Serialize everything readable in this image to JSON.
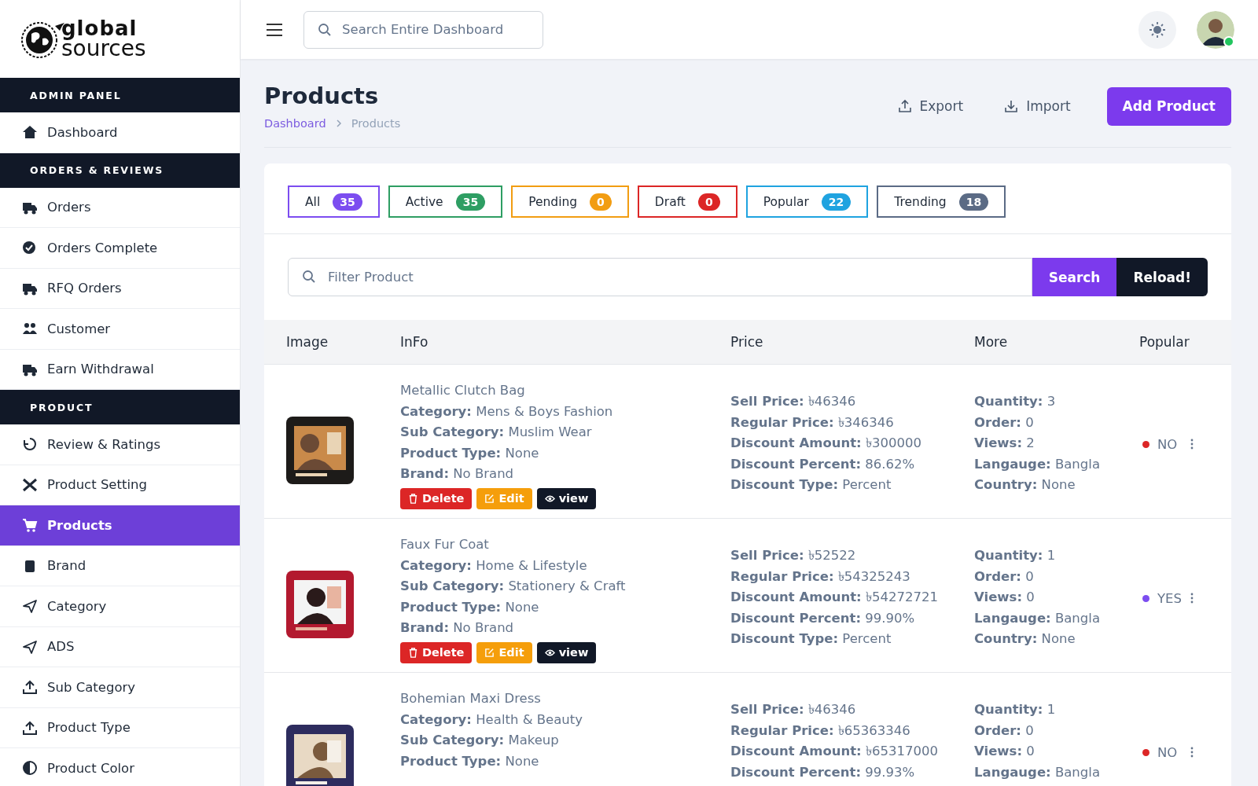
{
  "logo": {
    "line_1": "global",
    "line_2": "sources"
  },
  "sidebar": [
    {
      "heading": "ADMIN PANEL",
      "items": [
        {
          "label": "Dashboard",
          "selected": false
        }
      ]
    },
    {
      "heading": "ORDERS & REVIEWS",
      "items": [
        {
          "label": "Orders",
          "selected": false
        },
        {
          "label": "Orders Complete",
          "selected": false
        },
        {
          "label": "RFQ Orders",
          "selected": false
        },
        {
          "label": "Customer",
          "selected": false
        },
        {
          "label": "Earn Withdrawal",
          "selected": false
        }
      ]
    },
    {
      "heading": "PRODUCT",
      "items": [
        {
          "label": "Review & Ratings",
          "selected": false
        },
        {
          "label": "Product Setting",
          "selected": false
        },
        {
          "label": "Products",
          "selected": true
        },
        {
          "label": "Brand",
          "selected": false
        },
        {
          "label": "Category",
          "selected": false
        },
        {
          "label": "ADS",
          "selected": false
        },
        {
          "label": "Sub Category",
          "selected": false
        },
        {
          "label": "Product Type",
          "selected": false
        },
        {
          "label": "Product Color",
          "selected": false
        }
      ]
    }
  ],
  "header": {
    "search": {
      "placeholder": "Search Entire Dashboard"
    }
  },
  "page": {
    "title": "Products",
    "breadcrumb": [
      {
        "label": "Dashboard",
        "selected": false
      },
      {
        "label": "Products",
        "selected": true
      }
    ],
    "actions": [
      {
        "kind": "export",
        "label": "Export"
      },
      {
        "kind": "import",
        "label": "Import"
      },
      {
        "kind": "primary",
        "label": "Add Product"
      }
    ]
  },
  "filter_tabs": [
    {
      "label": "All",
      "count": "35",
      "color": "#7c4df0"
    },
    {
      "label": "Active",
      "count": "35",
      "color": "#2e9e63"
    },
    {
      "label": "Pending",
      "count": "0",
      "color": "#f29d12"
    },
    {
      "label": "Draft",
      "count": "0",
      "color": "#dc2626"
    },
    {
      "label": "Popular",
      "count": "22",
      "color": "#1fa3e0"
    },
    {
      "label": "Trending",
      "count": "18",
      "color": "#5b6b85"
    }
  ],
  "filter": {
    "placeholder": "Filter Product",
    "buttons": [
      {
        "kind": "search",
        "label": "Search"
      },
      {
        "kind": "reload",
        "label": "Reload!"
      }
    ]
  },
  "table": {
    "columns": [
      "Image",
      "InFo",
      "Price",
      "More",
      "Popular"
    ],
    "rows": [
      {
        "name": "Metallic Clutch Bag",
        "info": [
          {
            "label": "Category:",
            "value": "Mens & Boys Fashion"
          },
          {
            "label": "Sub Category:",
            "value": "Muslim Wear"
          },
          {
            "label": "Product Type:",
            "value": "None"
          },
          {
            "label": "Brand:",
            "value": "No Brand"
          }
        ],
        "actions": [
          {
            "kind": "delete",
            "label": "Delete"
          },
          {
            "kind": "edit",
            "label": "Edit"
          },
          {
            "kind": "view",
            "label": "view"
          }
        ],
        "price": [
          {
            "label": "Sell Price:",
            "value": "৳46346"
          },
          {
            "label": "Regular Price:",
            "value": "৳346346"
          },
          {
            "label": "Discount Amount:",
            "value": "৳300000"
          },
          {
            "label": "Discount Percent:",
            "value": "86.62%"
          },
          {
            "label": "Discount Type:",
            "value": "Percent"
          }
        ],
        "more": [
          {
            "label": "Quantity:",
            "value": "3"
          },
          {
            "label": "Order:",
            "value": "0"
          },
          {
            "label": "Views:",
            "value": "2"
          },
          {
            "label": "Langauge:",
            "value": "Bangla"
          },
          {
            "label": "Country:",
            "value": "None"
          }
        ],
        "popular": {
          "label": "NO",
          "color": "#dc2626"
        }
      },
      {
        "name": "Faux Fur Coat",
        "info": [
          {
            "label": "Category:",
            "value": "Home & Lifestyle"
          },
          {
            "label": "Sub Category:",
            "value": "Stationery & Craft"
          },
          {
            "label": "Product Type:",
            "value": "None"
          },
          {
            "label": "Brand:",
            "value": "No Brand"
          }
        ],
        "actions": [
          {
            "kind": "delete",
            "label": "Delete"
          },
          {
            "kind": "edit",
            "label": "Edit"
          },
          {
            "kind": "view",
            "label": "view"
          }
        ],
        "price": [
          {
            "label": "Sell Price:",
            "value": "৳52522"
          },
          {
            "label": "Regular Price:",
            "value": "৳54325243"
          },
          {
            "label": "Discount Amount:",
            "value": "৳54272721"
          },
          {
            "label": "Discount Percent:",
            "value": "99.90%"
          },
          {
            "label": "Discount Type:",
            "value": "Percent"
          }
        ],
        "more": [
          {
            "label": "Quantity:",
            "value": "1"
          },
          {
            "label": "Order:",
            "value": "0"
          },
          {
            "label": "Views:",
            "value": "0"
          },
          {
            "label": "Langauge:",
            "value": "Bangla"
          },
          {
            "label": "Country:",
            "value": "None"
          }
        ],
        "popular": {
          "label": "YES",
          "color": "#7c4df0"
        }
      },
      {
        "name": "Bohemian Maxi Dress",
        "info": [
          {
            "label": "Category:",
            "value": "Health & Beauty"
          },
          {
            "label": "Sub Category:",
            "value": "Makeup"
          },
          {
            "label": "Product Type:",
            "value": "None"
          }
        ],
        "actions": [],
        "price": [
          {
            "label": "Sell Price:",
            "value": "৳46346"
          },
          {
            "label": "Regular Price:",
            "value": "৳65363346"
          },
          {
            "label": "Discount Amount:",
            "value": "৳65317000"
          },
          {
            "label": "Discount Percent:",
            "value": "99.93%"
          }
        ],
        "more": [
          {
            "label": "Quantity:",
            "value": "1"
          },
          {
            "label": "Order:",
            "value": "0"
          },
          {
            "label": "Views:",
            "value": "0"
          },
          {
            "label": "Langauge:",
            "value": "Bangla"
          }
        ],
        "popular": {
          "label": "NO",
          "color": "#dc2626"
        }
      }
    ]
  }
}
